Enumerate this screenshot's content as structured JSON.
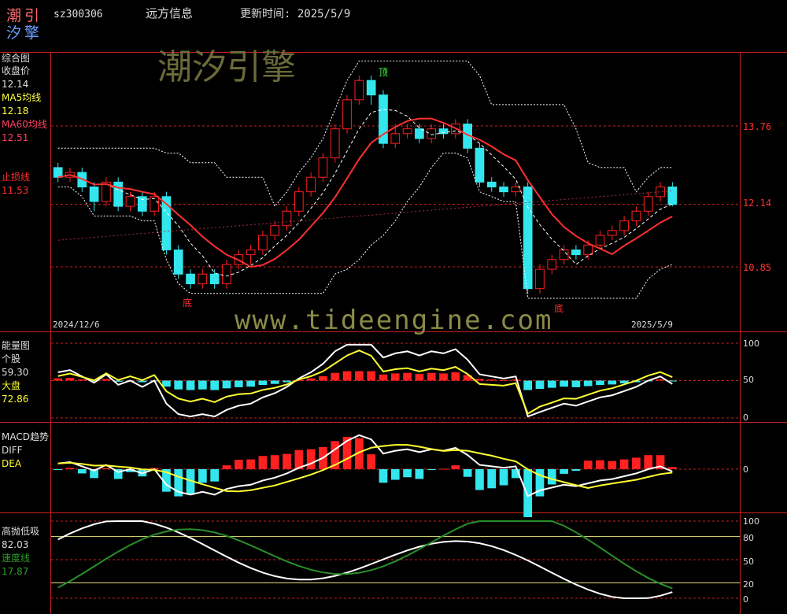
{
  "header": {
    "logo_line1": "潮引",
    "logo_line2": "汐擎",
    "code": "sz300306",
    "name": "远方信息",
    "updated": "更新时间: 2025/5/9"
  },
  "watermark": {
    "brand": "潮汐引擎",
    "url": "www.tideengine.com"
  },
  "colors": {
    "up": "#ff2020",
    "down": "#33e6ee",
    "ma5": "#ffffff",
    "ma60": "#ff3030",
    "yellow": "#ffff30",
    "green": "#2a8f2a",
    "grid": "#cc2020"
  },
  "chart_data": [
    {
      "type": "candlestick",
      "panel": "综合图",
      "legend": [
        {
          "label": "收盘价",
          "value": "12.14",
          "color": "#ffffff"
        },
        {
          "label": "MA5均线",
          "value": "12.18",
          "color": "#ffff40"
        },
        {
          "label": "MA60均线",
          "value": "12.51",
          "color": "#ff4060"
        },
        {
          "label": "止损线",
          "value": "11.53",
          "color": "#ff3030"
        }
      ],
      "y_ticks": [
        "13.76",
        "12.14",
        "10.85"
      ],
      "y_tick_values": [
        13.76,
        12.14,
        10.85
      ],
      "annotations": [
        {
          "text": "顶",
          "color": "#40ff40"
        },
        {
          "text": "底",
          "color": "#ff3030"
        },
        {
          "text": "底",
          "color": "#ff3030"
        }
      ],
      "x_labels": [
        "2024/12/6",
        "2025/5/9"
      ],
      "ohlc_sketch": [
        [
          12.9,
          12.7,
          13.0,
          12.6
        ],
        [
          12.7,
          12.8,
          12.9,
          12.6
        ],
        [
          12.8,
          12.5,
          12.9,
          12.4
        ],
        [
          12.5,
          12.2,
          12.6,
          12.0
        ],
        [
          12.2,
          12.6,
          12.7,
          12.1
        ],
        [
          12.6,
          12.1,
          12.7,
          12.0
        ],
        [
          12.1,
          12.3,
          12.4,
          12.0
        ],
        [
          12.3,
          12.0,
          12.4,
          11.9
        ],
        [
          12.0,
          12.3,
          12.4,
          11.9
        ],
        [
          12.3,
          11.2,
          12.4,
          11.1
        ],
        [
          11.2,
          10.7,
          11.3,
          10.6
        ],
        [
          10.7,
          10.5,
          10.8,
          10.4
        ],
        [
          10.5,
          10.7,
          10.8,
          10.4
        ],
        [
          10.7,
          10.5,
          10.8,
          10.4
        ],
        [
          10.5,
          10.9,
          11.0,
          10.4
        ],
        [
          10.9,
          11.1,
          11.2,
          10.8
        ],
        [
          11.1,
          11.2,
          11.3,
          10.9
        ],
        [
          11.2,
          11.5,
          11.6,
          11.1
        ],
        [
          11.5,
          11.7,
          11.8,
          11.4
        ],
        [
          11.7,
          12.0,
          12.1,
          11.6
        ],
        [
          12.0,
          12.4,
          12.5,
          11.9
        ],
        [
          12.4,
          12.7,
          12.8,
          12.3
        ],
        [
          12.7,
          13.1,
          13.2,
          12.6
        ],
        [
          13.1,
          13.7,
          13.8,
          13.0
        ],
        [
          13.7,
          14.3,
          14.4,
          13.6
        ],
        [
          14.3,
          14.7,
          14.8,
          14.2
        ],
        [
          14.7,
          14.4,
          14.8,
          14.2
        ],
        [
          14.4,
          13.4,
          14.5,
          13.3
        ],
        [
          13.4,
          13.6,
          13.8,
          13.3
        ],
        [
          13.6,
          13.7,
          13.8,
          13.5
        ],
        [
          13.7,
          13.5,
          13.8,
          13.4
        ],
        [
          13.5,
          13.7,
          13.8,
          13.4
        ],
        [
          13.7,
          13.6,
          13.8,
          13.5
        ],
        [
          13.6,
          13.8,
          13.9,
          13.5
        ],
        [
          13.8,
          13.3,
          13.9,
          13.2
        ],
        [
          13.3,
          12.6,
          13.4,
          12.5
        ],
        [
          12.6,
          12.5,
          12.7,
          12.4
        ],
        [
          12.5,
          12.4,
          12.6,
          12.3
        ],
        [
          12.4,
          12.5,
          12.6,
          12.3
        ],
        [
          12.5,
          10.4,
          12.6,
          10.3
        ],
        [
          10.4,
          10.8,
          10.9,
          10.3
        ],
        [
          10.8,
          11.0,
          11.1,
          10.7
        ],
        [
          11.0,
          11.2,
          11.3,
          10.9
        ],
        [
          11.2,
          11.1,
          11.3,
          11.0
        ],
        [
          11.1,
          11.3,
          11.4,
          11.0
        ],
        [
          11.3,
          11.5,
          11.6,
          11.2
        ],
        [
          11.5,
          11.6,
          11.7,
          11.4
        ],
        [
          11.6,
          11.8,
          11.9,
          11.5
        ],
        [
          11.8,
          12.0,
          12.1,
          11.7
        ],
        [
          12.0,
          12.3,
          12.4,
          11.9
        ],
        [
          12.3,
          12.5,
          12.6,
          12.2
        ],
        [
          12.5,
          12.14,
          12.6,
          12.1
        ]
      ]
    },
    {
      "type": "line",
      "panel": "能量图",
      "legend": [
        {
          "label": "个股",
          "value": "59.30",
          "color": "#ffffff"
        },
        {
          "label": "大盘",
          "value": "72.86",
          "color": "#ffff30"
        }
      ],
      "y_ticks": [
        "100",
        "50",
        "0"
      ]
    },
    {
      "type": "bar",
      "panel": "MACD趋势",
      "legend": [
        {
          "label": "DIFF",
          "color": "#ffffff"
        },
        {
          "label": "DEA",
          "color": "#ffff30"
        }
      ],
      "y_ticks": [
        "0"
      ]
    },
    {
      "type": "line",
      "panel": "高抛低吸",
      "legend": [
        {
          "label": "82.03",
          "color": "#ffffff"
        },
        {
          "label": "速度线",
          "color": "#2a8f2a"
        },
        {
          "label": "17.87",
          "color": "#2a8f2a"
        }
      ],
      "y_ticks": [
        "100",
        "80",
        "50",
        "20",
        "0"
      ]
    }
  ]
}
